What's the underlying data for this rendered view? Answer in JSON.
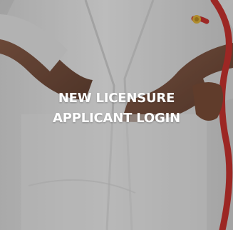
{
  "tile": {
    "title_line1": "NEW LICENSURE",
    "title_line2": "APPLICANT LOGIN"
  },
  "colors": {
    "caption_text": "#ffffff",
    "stethoscope_red": "#c8322f",
    "stethoscope_yellow": "#e0b23a"
  }
}
